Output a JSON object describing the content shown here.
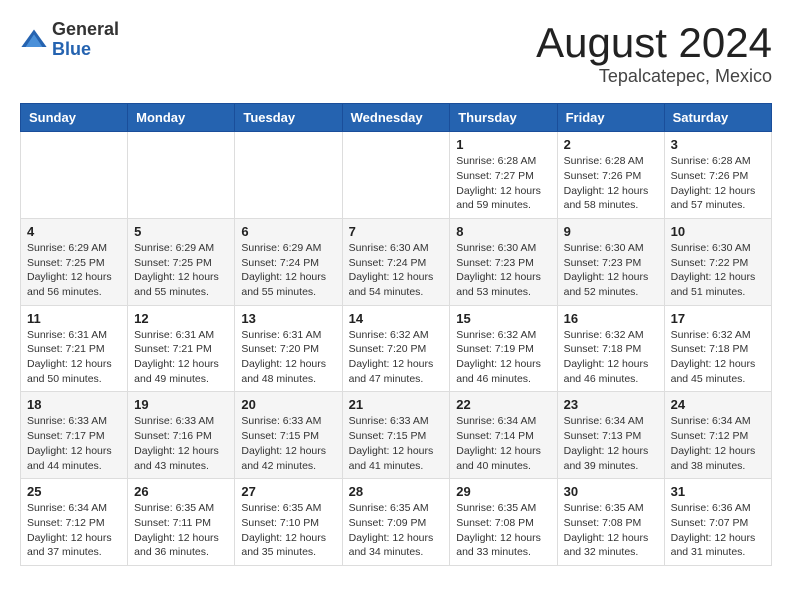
{
  "header": {
    "logo_general": "General",
    "logo_blue": "Blue",
    "main_title": "August 2024",
    "subtitle": "Tepalcatepec, Mexico"
  },
  "calendar": {
    "days_of_week": [
      "Sunday",
      "Monday",
      "Tuesday",
      "Wednesday",
      "Thursday",
      "Friday",
      "Saturday"
    ],
    "weeks": [
      [
        {
          "day": "",
          "info": ""
        },
        {
          "day": "",
          "info": ""
        },
        {
          "day": "",
          "info": ""
        },
        {
          "day": "",
          "info": ""
        },
        {
          "day": "1",
          "info": "Sunrise: 6:28 AM\nSunset: 7:27 PM\nDaylight: 12 hours and 59 minutes."
        },
        {
          "day": "2",
          "info": "Sunrise: 6:28 AM\nSunset: 7:26 PM\nDaylight: 12 hours and 58 minutes."
        },
        {
          "day": "3",
          "info": "Sunrise: 6:28 AM\nSunset: 7:26 PM\nDaylight: 12 hours and 57 minutes."
        }
      ],
      [
        {
          "day": "4",
          "info": "Sunrise: 6:29 AM\nSunset: 7:25 PM\nDaylight: 12 hours and 56 minutes."
        },
        {
          "day": "5",
          "info": "Sunrise: 6:29 AM\nSunset: 7:25 PM\nDaylight: 12 hours and 55 minutes."
        },
        {
          "day": "6",
          "info": "Sunrise: 6:29 AM\nSunset: 7:24 PM\nDaylight: 12 hours and 55 minutes."
        },
        {
          "day": "7",
          "info": "Sunrise: 6:30 AM\nSunset: 7:24 PM\nDaylight: 12 hours and 54 minutes."
        },
        {
          "day": "8",
          "info": "Sunrise: 6:30 AM\nSunset: 7:23 PM\nDaylight: 12 hours and 53 minutes."
        },
        {
          "day": "9",
          "info": "Sunrise: 6:30 AM\nSunset: 7:23 PM\nDaylight: 12 hours and 52 minutes."
        },
        {
          "day": "10",
          "info": "Sunrise: 6:30 AM\nSunset: 7:22 PM\nDaylight: 12 hours and 51 minutes."
        }
      ],
      [
        {
          "day": "11",
          "info": "Sunrise: 6:31 AM\nSunset: 7:21 PM\nDaylight: 12 hours and 50 minutes."
        },
        {
          "day": "12",
          "info": "Sunrise: 6:31 AM\nSunset: 7:21 PM\nDaylight: 12 hours and 49 minutes."
        },
        {
          "day": "13",
          "info": "Sunrise: 6:31 AM\nSunset: 7:20 PM\nDaylight: 12 hours and 48 minutes."
        },
        {
          "day": "14",
          "info": "Sunrise: 6:32 AM\nSunset: 7:20 PM\nDaylight: 12 hours and 47 minutes."
        },
        {
          "day": "15",
          "info": "Sunrise: 6:32 AM\nSunset: 7:19 PM\nDaylight: 12 hours and 46 minutes."
        },
        {
          "day": "16",
          "info": "Sunrise: 6:32 AM\nSunset: 7:18 PM\nDaylight: 12 hours and 46 minutes."
        },
        {
          "day": "17",
          "info": "Sunrise: 6:32 AM\nSunset: 7:18 PM\nDaylight: 12 hours and 45 minutes."
        }
      ],
      [
        {
          "day": "18",
          "info": "Sunrise: 6:33 AM\nSunset: 7:17 PM\nDaylight: 12 hours and 44 minutes."
        },
        {
          "day": "19",
          "info": "Sunrise: 6:33 AM\nSunset: 7:16 PM\nDaylight: 12 hours and 43 minutes."
        },
        {
          "day": "20",
          "info": "Sunrise: 6:33 AM\nSunset: 7:15 PM\nDaylight: 12 hours and 42 minutes."
        },
        {
          "day": "21",
          "info": "Sunrise: 6:33 AM\nSunset: 7:15 PM\nDaylight: 12 hours and 41 minutes."
        },
        {
          "day": "22",
          "info": "Sunrise: 6:34 AM\nSunset: 7:14 PM\nDaylight: 12 hours and 40 minutes."
        },
        {
          "day": "23",
          "info": "Sunrise: 6:34 AM\nSunset: 7:13 PM\nDaylight: 12 hours and 39 minutes."
        },
        {
          "day": "24",
          "info": "Sunrise: 6:34 AM\nSunset: 7:12 PM\nDaylight: 12 hours and 38 minutes."
        }
      ],
      [
        {
          "day": "25",
          "info": "Sunrise: 6:34 AM\nSunset: 7:12 PM\nDaylight: 12 hours and 37 minutes."
        },
        {
          "day": "26",
          "info": "Sunrise: 6:35 AM\nSunset: 7:11 PM\nDaylight: 12 hours and 36 minutes."
        },
        {
          "day": "27",
          "info": "Sunrise: 6:35 AM\nSunset: 7:10 PM\nDaylight: 12 hours and 35 minutes."
        },
        {
          "day": "28",
          "info": "Sunrise: 6:35 AM\nSunset: 7:09 PM\nDaylight: 12 hours and 34 minutes."
        },
        {
          "day": "29",
          "info": "Sunrise: 6:35 AM\nSunset: 7:08 PM\nDaylight: 12 hours and 33 minutes."
        },
        {
          "day": "30",
          "info": "Sunrise: 6:35 AM\nSunset: 7:08 PM\nDaylight: 12 hours and 32 minutes."
        },
        {
          "day": "31",
          "info": "Sunrise: 6:36 AM\nSunset: 7:07 PM\nDaylight: 12 hours and 31 minutes."
        }
      ]
    ]
  }
}
